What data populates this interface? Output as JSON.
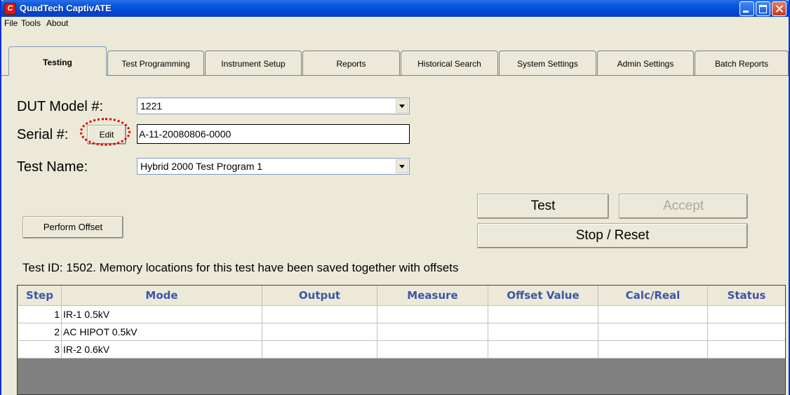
{
  "window": {
    "title": "QuadTech CaptivATE",
    "app_icon_glyph": "C"
  },
  "menu": [
    "File",
    "Tools",
    "About"
  ],
  "tabs": [
    {
      "label": "Testing",
      "active": true
    },
    {
      "label": "Test Programming",
      "active": false
    },
    {
      "label": "Instrument Setup",
      "active": false
    },
    {
      "label": "Reports",
      "active": false
    },
    {
      "label": "Historical Search",
      "active": false
    },
    {
      "label": "System Settings",
      "active": false
    },
    {
      "label": "Admin Settings",
      "active": false
    },
    {
      "label": "Batch Reports",
      "active": false
    }
  ],
  "form": {
    "dut_label": "DUT Model #:",
    "dut_value": "1221",
    "serial_label": "Serial #:",
    "edit_label": "Edit",
    "serial_value": "A-11-20080806-0000",
    "testname_label": "Test Name:",
    "testname_value": "Hybrid 2000 Test Program 1"
  },
  "buttons": {
    "perform_offset": "Perform Offset",
    "test": "Test",
    "accept": "Accept",
    "stop_reset": "Stop / Reset"
  },
  "status": "Test ID: 1502. Memory locations for this test have been saved together with offsets",
  "table": {
    "columns": [
      "Step",
      "Mode",
      "Output",
      "Measure",
      "Offset Value",
      "Calc/Real",
      "Status"
    ],
    "rows": [
      [
        "1",
        "IR-1 0.5kV",
        "",
        "",
        "",
        "",
        ""
      ],
      [
        "2",
        "AC HIPOT 0.5kV",
        "",
        "",
        "",
        "",
        ""
      ],
      [
        "3",
        "IR-2 0.6kV",
        "",
        "",
        "",
        "",
        ""
      ]
    ]
  },
  "colors": {
    "titlebar": "#0a5ae0",
    "header_text": "#3c55a8",
    "annotation_circle": "#e00000",
    "grid_empty": "#808080"
  }
}
